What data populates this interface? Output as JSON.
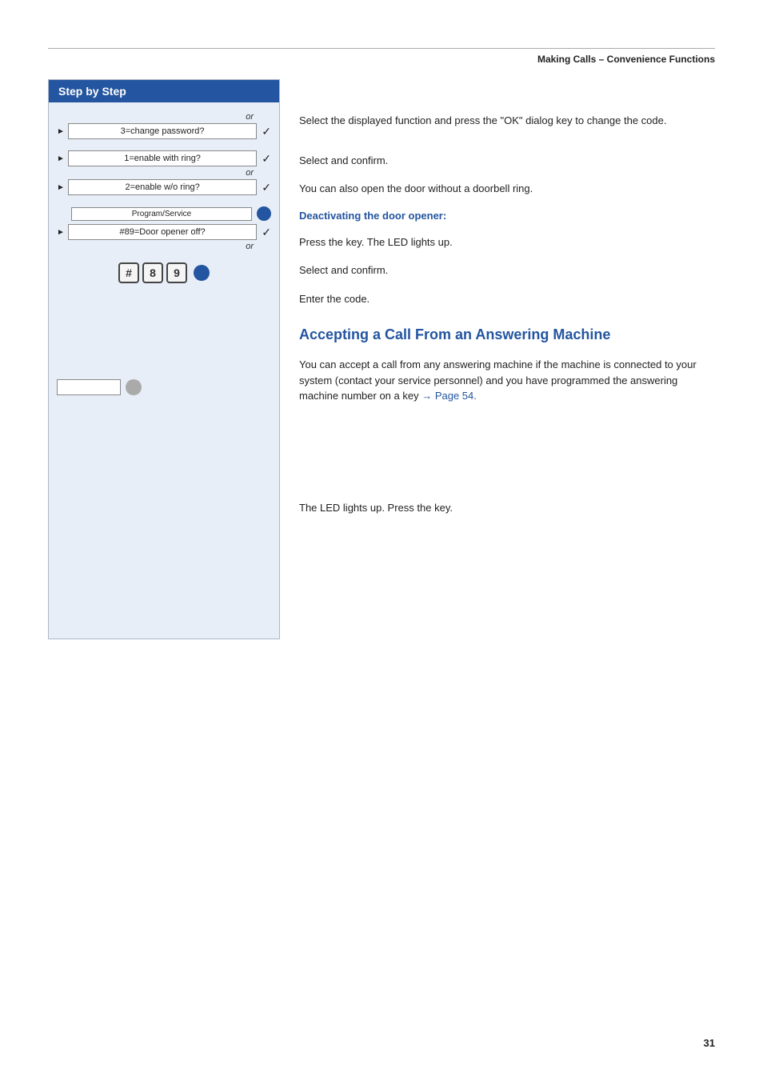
{
  "header": {
    "title": "Making Calls – Convenience Functions"
  },
  "left": {
    "box_title": "Step by Step",
    "rows": [
      {
        "id": "change-password",
        "or_above": true,
        "arrow": true,
        "button_label": "3=change password?",
        "check": true
      },
      {
        "id": "enable-with-ring",
        "or_above": false,
        "arrow": true,
        "button_label": "1=enable with ring?",
        "check": true
      },
      {
        "id": "enable-wo-ring",
        "or_above": true,
        "arrow": true,
        "button_label": "2=enable w/o ring?",
        "check": true
      },
      {
        "id": "program-service",
        "type": "program-service",
        "button_label": "Program/Service"
      },
      {
        "id": "door-opener-off",
        "or_below": true,
        "arrow": true,
        "button_label": "#89=Door opener off?",
        "check": true
      }
    ],
    "key_icons": [
      "#",
      "8",
      "9"
    ],
    "am_key": {
      "show": true
    }
  },
  "right": {
    "sections": [
      {
        "id": "change-password-desc",
        "text": "Select the displayed function and press the \"OK\" dialog key to change the code."
      },
      {
        "id": "select-confirm-1",
        "text": "Select and confirm."
      },
      {
        "id": "also-open-door",
        "text": "You can also open the door without a doorbell ring."
      },
      {
        "id": "deactivating-title",
        "type": "subheading",
        "text": "Deactivating the door opener:"
      },
      {
        "id": "press-key-led",
        "text": "Press the key. The LED lights up."
      },
      {
        "id": "select-confirm-2",
        "text": "Select and confirm."
      },
      {
        "id": "enter-code",
        "text": "Enter the code."
      },
      {
        "id": "accepting-heading",
        "type": "heading",
        "text": "Accepting a Call From an Answering Machine"
      },
      {
        "id": "accepting-desc",
        "text": "You can accept a call from any answering machine if the machine is connected to your system (contact your service personnel) and you have programmed the answering machine number on a key → Page 54."
      },
      {
        "id": "led-lights",
        "text": "The LED lights up. Press the key."
      }
    ]
  },
  "page_number": "31"
}
